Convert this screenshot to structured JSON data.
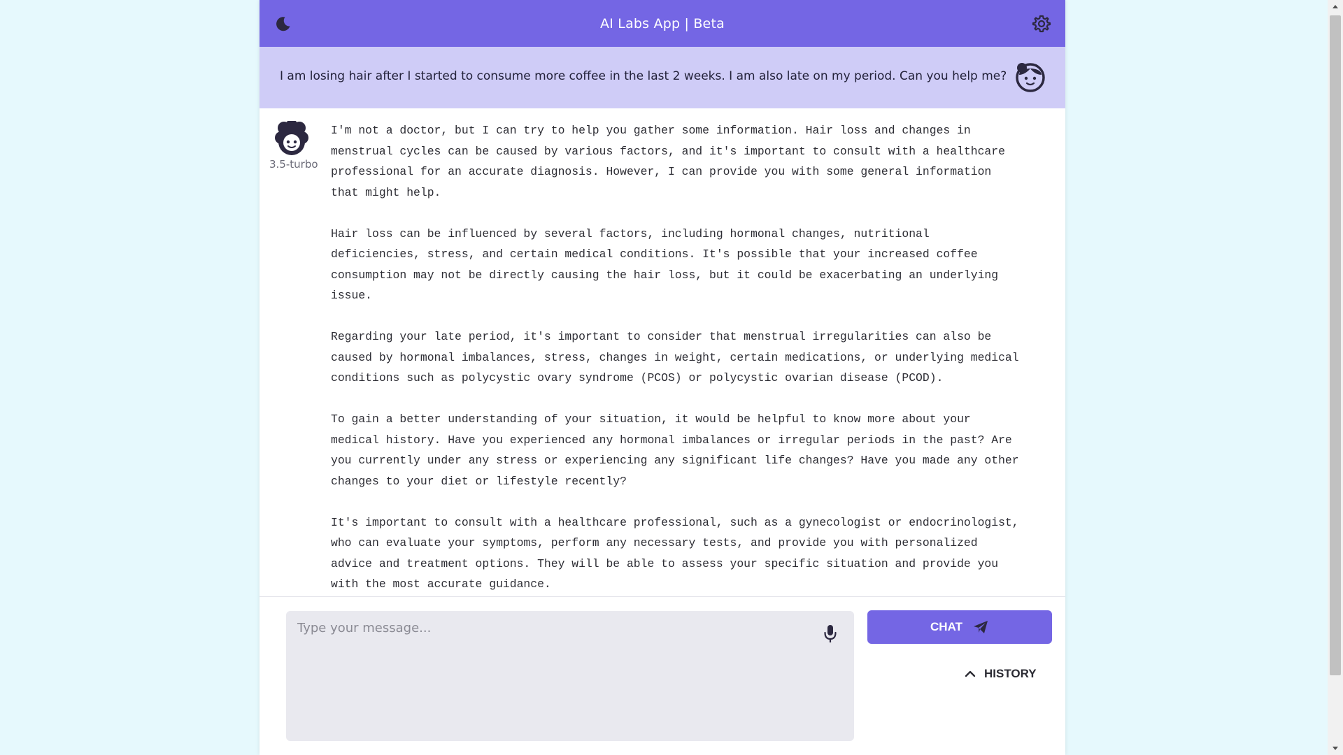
{
  "header": {
    "title": "AI Labs App | Beta",
    "left_icon": "moon-icon",
    "right_icon": "gear-icon",
    "brand_color": "#7466e4"
  },
  "conversation": {
    "user_message": "I am losing hair after I started to consume more coffee in the last 2 weeks. I am also late on my period. Can you help me?",
    "user_bubble_color": "#cfccf7",
    "assistant": {
      "model_label": "3.5-turbo",
      "paragraphs": [
        "I'm not a doctor, but I can try to help you gather some information. Hair loss and changes in\nmenstrual cycles can be caused by various factors, and it's important to consult with a healthcare\nprofessional for an accurate diagnosis. However, I can provide you with some general information\nthat might help.",
        "Hair loss can be influenced by several factors, including hormonal changes, nutritional\ndeficiencies, stress, and certain medical conditions. It's possible that your increased coffee\nconsumption may not be directly causing the hair loss, but it could be exacerbating an underlying\nissue.",
        "Regarding your late period, it's important to consider that menstrual irregularities can also be\ncaused by hormonal imbalances, stress, changes in weight, certain medications, or underlying medical\nconditions such as polycystic ovary syndrome (PCOS) or polycystic ovarian disease (PCOD).",
        "To gain a better understanding of your situation, it would be helpful to know more about your\nmedical history. Have you experienced any hormonal imbalances or irregular periods in the past? Are\nyou currently under any stress or experiencing any significant life changes? Have you made any other\nchanges to your diet or lifestyle recently?",
        "It's important to consult with a healthcare professional, such as a gynecologist or endocrinologist,\nwho can evaluate your symptoms, perform any necessary tests, and provide you with personalized\nadvice and treatment options. They will be able to assess your specific situation and provide you\nwith the most accurate guidance."
      ]
    }
  },
  "composer": {
    "placeholder": "Type your message...",
    "value": "",
    "mic_icon": "microphone-icon",
    "chat_button_label": "CHAT",
    "chat_button_icon": "send-icon",
    "history_label": "HISTORY",
    "history_icon": "chevron-up-icon"
  }
}
